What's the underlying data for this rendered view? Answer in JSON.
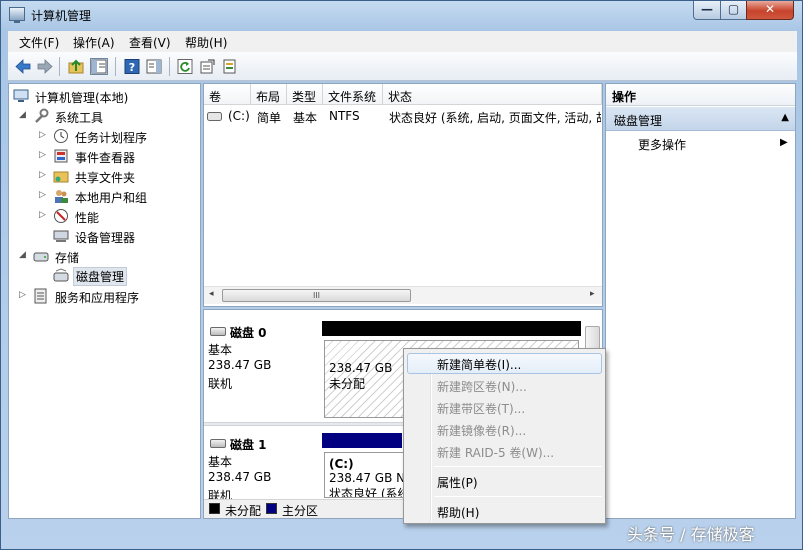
{
  "window": {
    "title": "计算机管理",
    "min_glyph": "—",
    "max_glyph": "▢",
    "close_glyph": "✕"
  },
  "menu": [
    "文件(F)",
    "操作(A)",
    "查看(V)",
    "帮助(H)"
  ],
  "toolbar_icons": [
    "back-arrow-icon",
    "forward-arrow-icon",
    "up-folder-icon",
    "show-tree-icon",
    "help-icon",
    "show-action-pane-icon",
    "refresh-icon",
    "properties-icon",
    "export-list-icon"
  ],
  "tree": {
    "root": "计算机管理(本地)",
    "system_tools": "系统工具",
    "task_scheduler": "任务计划程序",
    "event_viewer": "事件查看器",
    "shared_folders": "共享文件夹",
    "local_users": "本地用户和组",
    "performance": "性能",
    "device_manager": "设备管理器",
    "storage": "存储",
    "disk_management": "磁盘管理",
    "services_apps": "服务和应用程序"
  },
  "volume_list": {
    "columns": [
      "卷",
      "布局",
      "类型",
      "文件系统",
      "状态"
    ],
    "rows": [
      {
        "volume": "(C:)",
        "layout": "简单",
        "type": "基本",
        "fs": "NTFS",
        "status": "状态良好 (系统, 启动, 页面文件, 活动, 故"
      }
    ],
    "scroll_grip": "III",
    "scroll_left": "◂",
    "scroll_right": "▸"
  },
  "disks": [
    {
      "name": "磁盘 0",
      "kind": "基本",
      "size": "238.47 GB",
      "state": "联机",
      "partition_size": "238.47 GB",
      "partition_label": "未分配"
    },
    {
      "name": "磁盘 1",
      "kind": "基本",
      "size": "238.47 GB",
      "state": "联机",
      "partition_drive": "(C:)",
      "partition_size": "238.47 GB N",
      "partition_status": "状态良好 (系统"
    }
  ],
  "legend": {
    "unallocated": "未分配",
    "primary": "主分区",
    "unallocated_color": "#000000",
    "primary_color": "#000080"
  },
  "actions": {
    "header": "操作",
    "section": "磁盘管理",
    "section_arrow": "▲",
    "more": "更多操作",
    "more_arrow": "▶"
  },
  "context_menu": {
    "items": [
      {
        "label": "新建简单卷(I)...",
        "enabled": true
      },
      {
        "label": "新建跨区卷(N)...",
        "enabled": false
      },
      {
        "label": "新建带区卷(T)...",
        "enabled": false
      },
      {
        "label": "新建镜像卷(R)...",
        "enabled": false
      },
      {
        "label": "新建 RAID-5 卷(W)...",
        "enabled": false
      },
      {
        "label": "属性(P)",
        "enabled": true
      },
      {
        "label": "帮助(H)",
        "enabled": true
      }
    ]
  },
  "watermark": "头条号 / 存储极客"
}
